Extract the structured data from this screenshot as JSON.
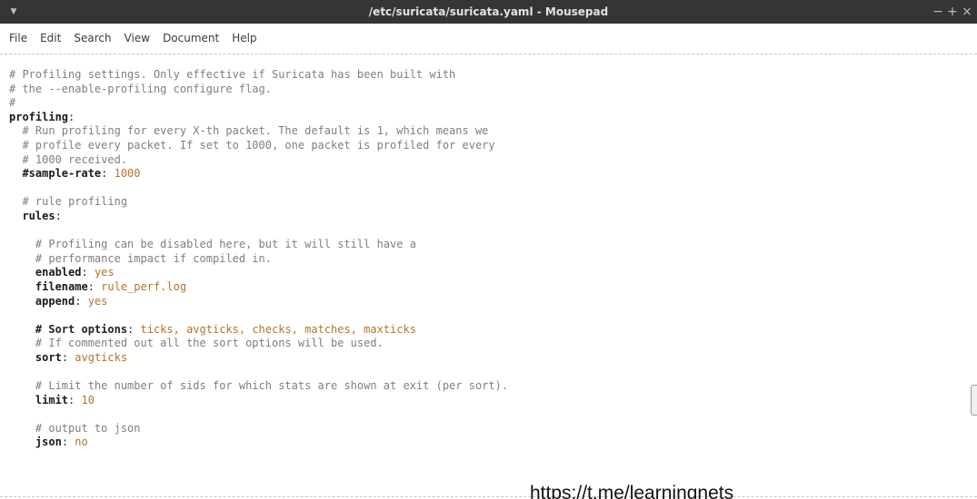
{
  "window": {
    "title": "/etc/suricata/suricata.yaml - Mousepad",
    "menu_icon": "triangle-down-icon",
    "controls": {
      "minimize": "−",
      "maximize": "+",
      "close": "×"
    }
  },
  "menubar": {
    "items": [
      "File",
      "Edit",
      "Search",
      "View",
      "Document",
      "Help"
    ]
  },
  "editor": {
    "lines": [
      [
        [
          "comment",
          "# Profiling settings. Only effective if Suricata has been built with"
        ]
      ],
      [
        [
          "comment",
          "# the --enable-profiling configure flag."
        ]
      ],
      [
        [
          "comment",
          "#"
        ]
      ],
      [
        [
          "key",
          "profiling"
        ],
        [
          "punct",
          ":"
        ]
      ],
      [
        [
          "comment",
          "  # Run profiling for every X-th packet. The default is 1, which means we"
        ]
      ],
      [
        [
          "comment",
          "  # profile every packet. If set to 1000, one packet is profiled for every"
        ]
      ],
      [
        [
          "comment",
          "  # 1000 received."
        ]
      ],
      [
        [
          "punct",
          "  "
        ],
        [
          "key",
          "#sample-rate"
        ],
        [
          "punct",
          ": "
        ],
        [
          "val",
          "1000"
        ]
      ],
      [
        [
          "punct",
          ""
        ]
      ],
      [
        [
          "comment",
          "  # rule profiling"
        ]
      ],
      [
        [
          "punct",
          "  "
        ],
        [
          "key",
          "rules"
        ],
        [
          "punct",
          ":"
        ]
      ],
      [
        [
          "punct",
          ""
        ]
      ],
      [
        [
          "comment",
          "    # Profiling can be disabled here, but it will still have a"
        ]
      ],
      [
        [
          "comment",
          "    # performance impact if compiled in."
        ]
      ],
      [
        [
          "punct",
          "    "
        ],
        [
          "key",
          "enabled"
        ],
        [
          "punct",
          ": "
        ],
        [
          "val",
          "yes"
        ]
      ],
      [
        [
          "punct",
          "    "
        ],
        [
          "key",
          "filename"
        ],
        [
          "punct",
          ": "
        ],
        [
          "val",
          "rule_perf.log"
        ]
      ],
      [
        [
          "punct",
          "    "
        ],
        [
          "key",
          "append"
        ],
        [
          "punct",
          ": "
        ],
        [
          "val",
          "yes"
        ]
      ],
      [
        [
          "punct",
          ""
        ]
      ],
      [
        [
          "punct",
          "    "
        ],
        [
          "bold-comment",
          "# Sort options"
        ],
        [
          "punct",
          ": "
        ],
        [
          "val",
          "ticks, avgticks, checks, matches, maxticks"
        ]
      ],
      [
        [
          "comment",
          "    # If commented out all the sort options will be used."
        ]
      ],
      [
        [
          "punct",
          "    "
        ],
        [
          "key",
          "sort"
        ],
        [
          "punct",
          ": "
        ],
        [
          "val",
          "avgticks"
        ]
      ],
      [
        [
          "punct",
          ""
        ]
      ],
      [
        [
          "comment",
          "    # Limit the number of sids for which stats are shown at exit (per sort)."
        ]
      ],
      [
        [
          "punct",
          "    "
        ],
        [
          "key",
          "limit"
        ],
        [
          "punct",
          ": "
        ],
        [
          "val",
          "10"
        ]
      ],
      [
        [
          "punct",
          ""
        ]
      ],
      [
        [
          "comment",
          "    # output to json"
        ]
      ],
      [
        [
          "punct",
          "    "
        ],
        [
          "key",
          "json"
        ],
        [
          "punct",
          ": "
        ],
        [
          "val",
          "no"
        ]
      ]
    ]
  },
  "watermark": "https://t.me/learningnets"
}
